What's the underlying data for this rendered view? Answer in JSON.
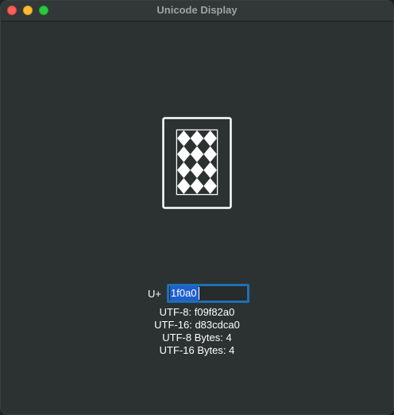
{
  "window": {
    "title": "Unicode Display"
  },
  "glyph": {
    "icon": "playing-card-back-icon",
    "colors": {
      "stroke": "#ffffff",
      "pattern": "#e8e8e8"
    }
  },
  "input": {
    "prefix": "U+",
    "value": "1f0a0",
    "focus_color": "#1f6fb5"
  },
  "encodings": {
    "utf8": "UTF-8: f09f82a0",
    "utf16": "UTF-16: d83cdca0",
    "utf8_bytes": "UTF-8 Bytes: 4",
    "utf16_bytes": "UTF-16 Bytes: 4"
  }
}
